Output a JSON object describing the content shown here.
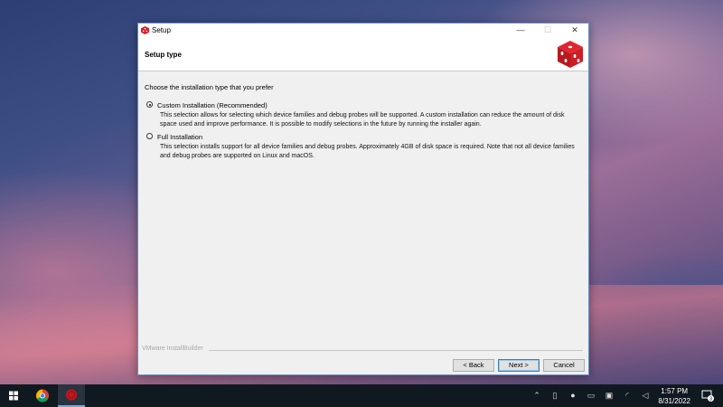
{
  "window": {
    "title": "Setup",
    "minimize_glyph": "—",
    "maximize_glyph": "☐",
    "close_glyph": "✕"
  },
  "header": {
    "heading": "Setup type"
  },
  "content": {
    "prompt": "Choose the installation type that you prefer",
    "options": [
      {
        "label": "Custom Installation (Recommended)",
        "selected": true,
        "description": "This selection allows for selecting which device families and debug probes will be supported.  A custom installation can reduce the amount of disk space used and improve performance.  It is possible to modify selections in the future by running the installer again."
      },
      {
        "label": "Full Installation",
        "selected": false,
        "description": "This selection installs support for all device families and debug probes.  Approximately 4GB of disk space is required.  Note that not all device families and debug probes are supported on Linux and macOS."
      }
    ]
  },
  "footer": {
    "brand": "VMware InstallBuilder",
    "back_label": "< Back",
    "next_label": "Next >",
    "cancel_label": "Cancel"
  },
  "taskbar": {
    "time": "1:57 PM",
    "date": "8/31/2022",
    "notification_count": "3",
    "apps": [
      "chrome-icon",
      "setup-icon"
    ]
  },
  "colors": {
    "accent": "#0078d7",
    "brand_red": "#d7202a",
    "taskbar": "#101820"
  }
}
